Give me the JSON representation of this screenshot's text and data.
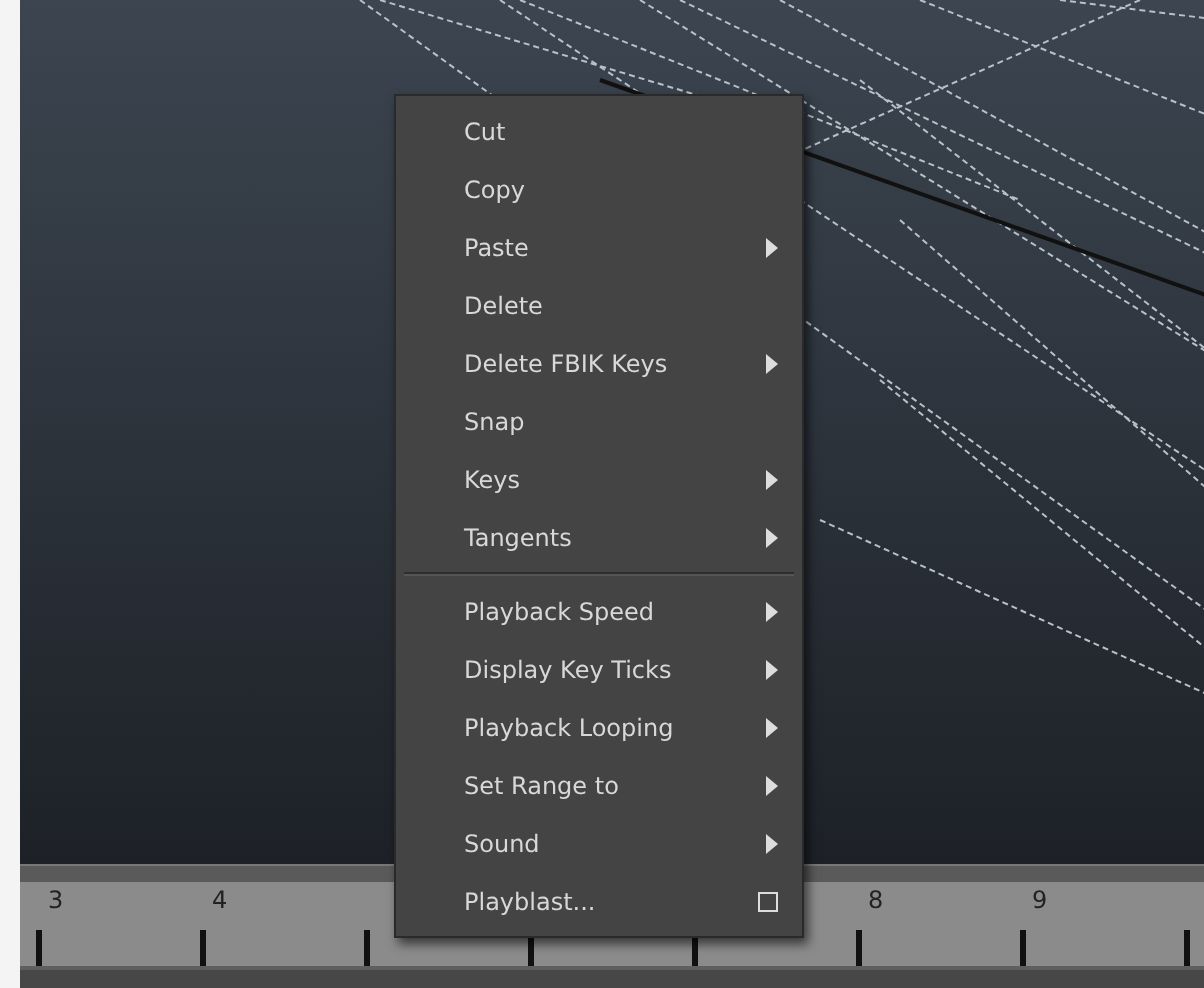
{
  "context_menu": {
    "items": [
      {
        "kind": "item",
        "label": "Cut"
      },
      {
        "kind": "item",
        "label": "Copy"
      },
      {
        "kind": "submenu",
        "label": "Paste"
      },
      {
        "kind": "item",
        "label": "Delete"
      },
      {
        "kind": "submenu",
        "label": "Delete FBIK Keys"
      },
      {
        "kind": "item",
        "label": "Snap"
      },
      {
        "kind": "submenu",
        "label": "Keys"
      },
      {
        "kind": "submenu",
        "label": "Tangents"
      },
      {
        "kind": "separator"
      },
      {
        "kind": "submenu",
        "label": "Playback Speed"
      },
      {
        "kind": "submenu",
        "label": "Display Key Ticks"
      },
      {
        "kind": "submenu",
        "label": "Playback Looping"
      },
      {
        "kind": "submenu",
        "label": "Set Range to"
      },
      {
        "kind": "submenu",
        "label": "Sound"
      },
      {
        "kind": "option",
        "label": "Playblast..."
      }
    ]
  },
  "timeline": {
    "ticks": [
      {
        "kind": "labeled",
        "label": "3"
      },
      {
        "kind": "labeled",
        "label": "4"
      },
      {
        "kind": "plain"
      },
      {
        "kind": "plain"
      },
      {
        "kind": "plain"
      },
      {
        "kind": "labeled",
        "label": "8"
      },
      {
        "kind": "labeled",
        "label": "9"
      },
      {
        "kind": "plain"
      }
    ]
  }
}
